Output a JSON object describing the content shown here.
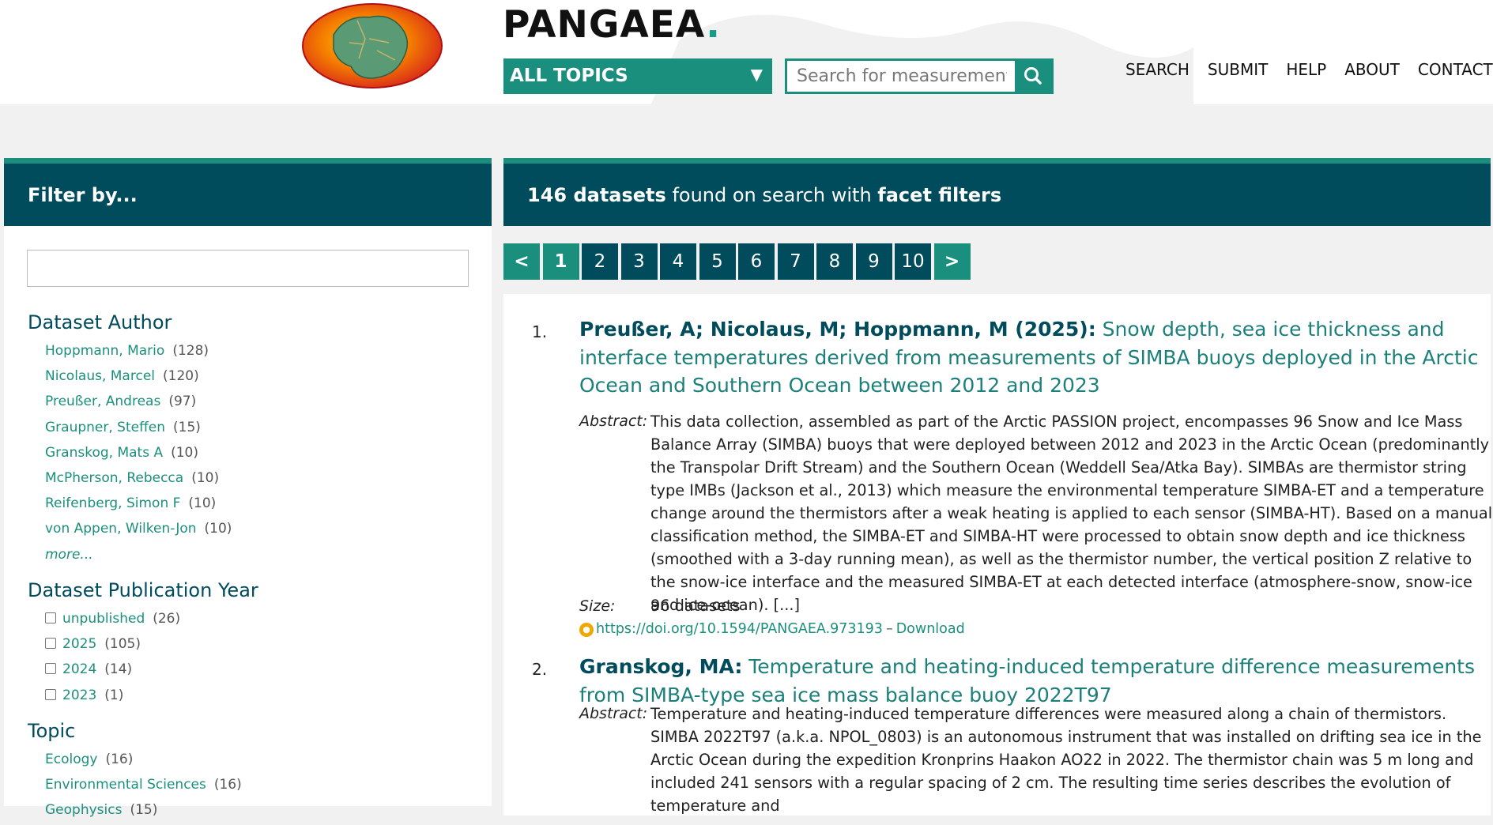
{
  "header": {
    "site_name": "PANGAEA",
    "site_dot": ".",
    "topics_label": "ALL TOPICS",
    "search_placeholder": "Search for measurements, paper authors, etc.",
    "nav": [
      "SEARCH",
      "SUBMIT",
      "HELP",
      "ABOUT",
      "CONTACT"
    ]
  },
  "sidebar": {
    "heading": "Filter by...",
    "filter_value": "",
    "facets": {
      "author": {
        "title": "Dataset Author",
        "items": [
          {
            "label": "Hoppmann, Mario",
            "count": "(128)"
          },
          {
            "label": "Nicolaus, Marcel",
            "count": "(120)"
          },
          {
            "label": "Preußer, Andreas",
            "count": "(97)"
          },
          {
            "label": "Graupner, Steffen",
            "count": "(15)"
          },
          {
            "label": "Granskog, Mats A",
            "count": "(10)"
          },
          {
            "label": "McPherson, Rebecca",
            "count": "(10)"
          },
          {
            "label": "Reifenberg, Simon F",
            "count": "(10)"
          },
          {
            "label": "von Appen, Wilken-Jon",
            "count": "(10)"
          }
        ],
        "more": "more..."
      },
      "year": {
        "title": "Dataset Publication Year",
        "items": [
          {
            "label": "unpublished",
            "count": "(26)"
          },
          {
            "label": "2025",
            "count": "(105)"
          },
          {
            "label": "2024",
            "count": "(14)"
          },
          {
            "label": "2023",
            "count": "(1)"
          }
        ]
      },
      "topic": {
        "title": "Topic",
        "items": [
          {
            "label": "Ecology",
            "count": "(16)"
          },
          {
            "label": "Environmental Sciences",
            "count": "(16)"
          },
          {
            "label": "Geophysics",
            "count": "(15)"
          }
        ]
      }
    }
  },
  "main": {
    "heading_count": "146 datasets",
    "heading_mid": " found on search with ",
    "heading_end": "facet filters",
    "pager": [
      "<",
      "1",
      "2",
      "3",
      "4",
      "5",
      "6",
      "7",
      "8",
      "9",
      "10",
      ">"
    ],
    "results": [
      {
        "num": "1.",
        "authors": "Preußer, A; Nicolaus, M; Hoppmann, M (2025):",
        "title": " Snow depth, sea ice thickness and interface temperatures derived from measurements of SIMBA buoys deployed in the Arctic Ocean and Southern Ocean between 2012 and 2023",
        "abstract_label": "Abstract:",
        "abstract": "This data collection, assembled as part of the Arctic PASSION project, encompasses 96 Snow and Ice Mass Balance Array (SIMBA) buoys that were deployed between 2012 and 2023 in the Arctic Ocean (predominantly the Transpolar Drift Stream) and the Southern Ocean (Weddell Sea/Atka Bay). SIMBAs are thermistor string type IMBs (Jackson et al., 2013) which measure the environmental temperature SIMBA-ET and a temperature change around the thermistors after a weak heating is applied to each sensor (SIMBA-HT). Based on a manual classification method, the SIMBA-ET and SIMBA-HT were processed to obtain snow depth and ice thickness (smoothed with a 3-day running mean), as well as the thermistor number, the vertical position Z relative to the snow-ice interface and the measured SIMBA-ET at each detected interface (atmosphere-snow, snow-ice and ice-ocean). [...]",
        "size_label": "Size:",
        "size": "96 datasets",
        "doi": "https://doi.org/10.1594/PANGAEA.973193",
        "sep": "–",
        "download": "Download"
      },
      {
        "num": "2.",
        "authors": "Granskog, MA:",
        "title": " Temperature and heating-induced temperature difference measurements from SIMBA-type sea ice mass balance buoy 2022T97",
        "abstract_label": "Abstract:",
        "abstract": "Temperature and heating-induced temperature differences were measured along a chain of thermistors. SIMBA 2022T97 (a.k.a. NPOL_0803) is an autonomous instrument that was installed on drifting sea ice in the Arctic Ocean during the expedition Kronprins Haakon AO22 in 2022. The thermistor chain was 5 m long and included 241 sensors with a regular spacing of 2 cm. The resulting time series describes the evolution of temperature and"
      }
    ]
  }
}
